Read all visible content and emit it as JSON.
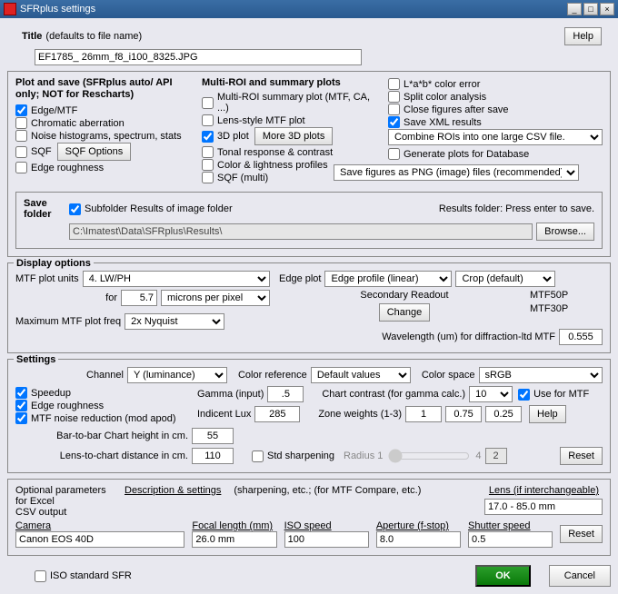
{
  "window": {
    "title": "SFRplus settings"
  },
  "title": {
    "label": "Title",
    "hint": "(defaults to file name)",
    "value": "EF1785_ 26mm_f8_i100_8325.JPG",
    "help": "Help"
  },
  "plotSave": {
    "heading": "Plot and save  (SFRplus auto/ API only;  NOT for Rescharts)",
    "edgeMtf": "Edge/MTF",
    "chromAb": "Chromatic aberration",
    "noiseHist": "Noise histograms, spectrum, stats",
    "sqf": "SQF",
    "sqfOptions": "SQF Options",
    "edgeRough": "Edge roughness"
  },
  "multiRoi": {
    "heading": "Multi-ROI and summary plots",
    "sum": "Multi-ROI summary plot (MTF, CA, ...)",
    "lens": "Lens-style MTF plot",
    "threeD": "3D plot",
    "more3d": "More 3D plots",
    "tonal": "Tonal response & contrast",
    "color": "Color & lightness profiles",
    "sqfMulti": "SQF (multi)"
  },
  "rightOpts": {
    "lab": "L*a*b* color error",
    "split": "Split color analysis",
    "close": "Close figures after save",
    "saveXml": "Save XML results",
    "combineCsv": "Combine ROIs into one large CSV file.",
    "genDb": "Generate plots for Database",
    "saveFigures": "Save figures as PNG (image) files (recommended)."
  },
  "saveFolder": {
    "label": "Save folder",
    "subChk": "Subfolder Results of image folder",
    "resultsLabel": "Results folder:  Press enter to save.",
    "path": "C:\\Imatest\\Data\\SFRplus\\Results\\",
    "browse": "Browse..."
  },
  "display": {
    "heading": "Display options",
    "mtfUnits": "MTF plot units",
    "mtfUnitsVal": "4. LW/PH",
    "forLabel": "for",
    "forVal": "5.7",
    "micronsSel": "microns per pixel",
    "maxFreq": "Maximum MTF plot freq",
    "maxFreqVal": "2x Nyquist",
    "edgePlot": "Edge plot",
    "edgePlotVal": "Edge profile (linear)",
    "crop": "Crop (default)",
    "secReadout": "Secondary Readout",
    "change": "Change",
    "mtf50p": "MTF50P",
    "mtf30p": "MTF30P",
    "wavelength": "Wavelength (um) for diffraction-ltd MTF",
    "wavelengthVal": "0.555"
  },
  "settings": {
    "heading": "Settings",
    "channel": "Channel",
    "channelVal": "Y (luminance)",
    "colorRef": "Color reference",
    "colorRefVal": "Default values",
    "colorSpace": "Color space",
    "colorSpaceVal": "sRGB",
    "speedup": "Speedup",
    "edgeRough": "Edge roughness",
    "mtfNoise": "MTF noise reduction (mod apod)",
    "gamma": "Gamma (input)",
    "gammaVal": ".5",
    "chartContrast": "Chart contrast (for gamma calc.)",
    "chartContrastVal": "10",
    "useForMtf": "Use for MTF",
    "incLux": "Indicent Lux",
    "incLuxVal": "285",
    "zoneWeights": "Zone weights (1-3)",
    "zw1": "1",
    "zw2": "0.75",
    "zw3": "0.25",
    "help": "Help",
    "barToBar": "Bar-to-bar Chart height in cm.",
    "barToBarVal": "55",
    "lensToChart": "Lens-to-chart distance in cm.",
    "lensToChartVal": "110",
    "stdSharp": "Std sharpening",
    "radius": "Radius  1",
    "sliderR": "4",
    "radius2": "2",
    "reset": "Reset"
  },
  "optional": {
    "heading1": "Optional parameters for Excel",
    "heading2": "CSV output",
    "descLabel": "Description & settings",
    "descHint": "(sharpening, etc.;  (for MTF Compare, etc.)",
    "lensLabel": "Lens (if interchangeable)",
    "lensVal": "17.0 - 85.0 mm",
    "camera": "Camera",
    "cameraVal": "Canon EOS 40D",
    "focal": "Focal length (mm)",
    "focalVal": "26.0 mm",
    "iso": "ISO speed",
    "isoVal": "100",
    "aperture": "Aperture (f-stop)",
    "apertureVal": "8.0",
    "shutter": "Shutter speed",
    "shutterVal": "0.5",
    "reset": "Reset"
  },
  "footer": {
    "isoStd": "ISO standard SFR",
    "ok": "OK",
    "cancel": "Cancel"
  }
}
